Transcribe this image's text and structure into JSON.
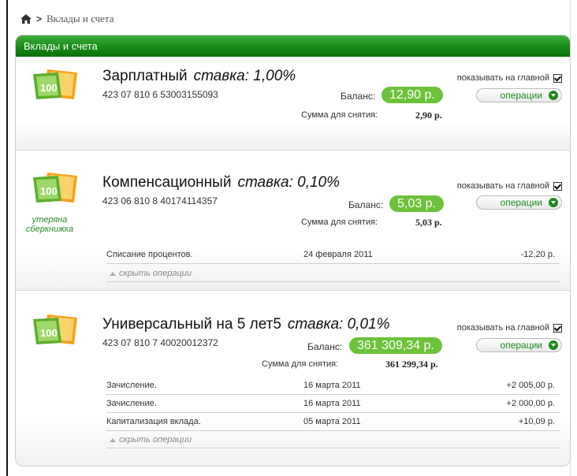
{
  "breadcrumb": {
    "current": "Вклады и счета"
  },
  "panel": {
    "title": "Вклады и счета"
  },
  "common": {
    "show_main": "показывать на главной",
    "operations": "операции",
    "balance_label": "Баланс:",
    "withdraw_label": "Сумма для снятия:",
    "hide_ops": "скрыть операции",
    "lost_book": "утеряна сберкнижка"
  },
  "accounts": [
    {
      "name": "Зарплатный",
      "rate": "ставка: 1,00%",
      "number": "423 07 810 6 53003155093",
      "balance": "12,90 р.",
      "withdraw": "2,90 р.",
      "operations": []
    },
    {
      "name": "Компенсационный",
      "rate": "ставка: 0,10%",
      "number": "423 06 810 8 40174114357",
      "balance": "5,03 р.",
      "withdraw": "5,03 р.",
      "operations": [
        {
          "desc": "Списание процентов.",
          "date": "24 февраля 2011",
          "amount": "-12,20 р."
        }
      ]
    },
    {
      "name": "Универсальный на 5 лет5",
      "rate": "ставка: 0,01%",
      "number": "423 07 810 7 40020012372",
      "balance": "361 309,34 р.",
      "withdraw": "361 299,34 р.",
      "operations": [
        {
          "desc": "Зачисление.",
          "date": "16 марта 2011",
          "amount": "+2 005,00 р."
        },
        {
          "desc": "Зачисление.",
          "date": "16 марта 2011",
          "amount": "+2 000,00 р."
        },
        {
          "desc": "Капитализация вклада.",
          "date": "05 марта 2011",
          "amount": "+10,09 р."
        }
      ]
    }
  ],
  "colors": {
    "header_green": "#168a16",
    "balance_green": "#6cc23a"
  },
  "icons": {
    "home": "home-icon",
    "money": "money-bills-icon"
  }
}
